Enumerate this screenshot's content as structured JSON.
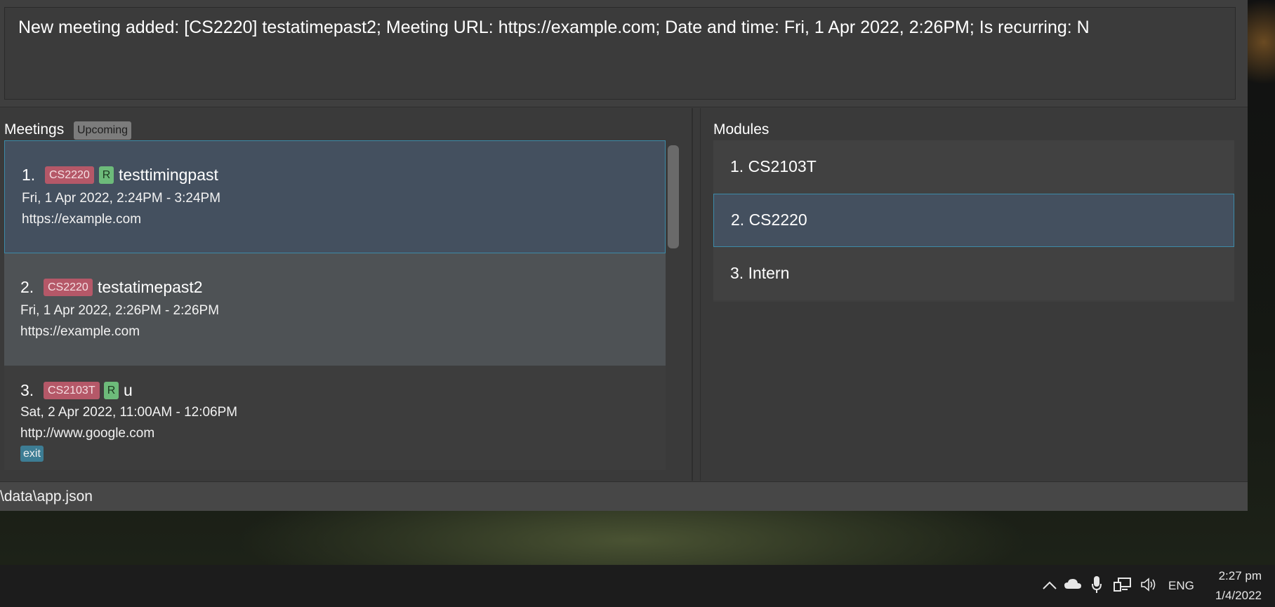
{
  "result": {
    "message": "New meeting added: [CS2220] testatimepast2; Meeting URL: https://example.com; Date and time: Fri, 1 Apr 2022, 2:26PM; Is recurring: N"
  },
  "meetings": {
    "title": "Meetings",
    "filter_tag": "Upcoming",
    "items": [
      {
        "index": "1.",
        "module": "CS2220",
        "recurring": "R",
        "name": "testtimingpast",
        "datetime": "Fri, 1 Apr 2022, 2:24PM  -  3:24PM",
        "url": "https://example.com"
      },
      {
        "index": "2.",
        "module": "CS2220",
        "name": "testatimepast2",
        "datetime": "Fri, 1 Apr 2022, 2:26PM  -  2:26PM",
        "url": "https://example.com"
      },
      {
        "index": "3.",
        "module": "CS2103T",
        "recurring": "R",
        "name": "u",
        "datetime": "Sat, 2 Apr 2022, 11:00AM  -  12:06PM",
        "url": "http://www.google.com",
        "tag": "exit"
      }
    ]
  },
  "modules": {
    "title": "Modules",
    "items": [
      {
        "label": "1.  CS2103T"
      },
      {
        "label": "2.  CS2220"
      },
      {
        "label": "3.  Intern"
      }
    ]
  },
  "status": {
    "path": "\\data\\app.json"
  },
  "taskbar": {
    "language": "ENG",
    "time": "2:27 pm",
    "date": "1/4/2022",
    "icons": [
      "chevron-up-icon",
      "cloud-icon",
      "microphone-icon",
      "network-icon",
      "speaker-icon"
    ]
  }
}
